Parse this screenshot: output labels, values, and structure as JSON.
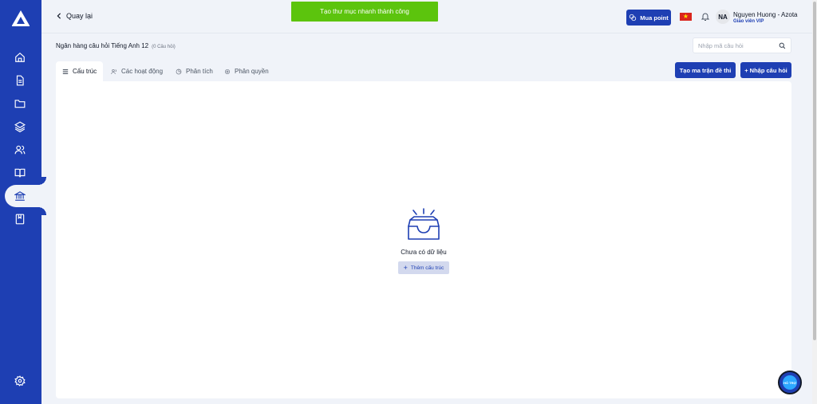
{
  "header": {
    "back_label": "Quay lại",
    "buy_point_label": "Mua point",
    "user_initials": "NA",
    "user_name": "Nguyen Huong - Azota",
    "user_role": "Giáo viên VIP"
  },
  "toast": {
    "message": "Tạo thư mục nhanh thành công"
  },
  "bank": {
    "title": "Ngân hàng câu hỏi Tiếng Anh 12",
    "count": "(0 Câu hỏi)"
  },
  "search": {
    "placeholder": "Nhập mã câu hỏi",
    "value": ""
  },
  "tabs": [
    {
      "label": "Cấu trúc",
      "icon": "list-icon",
      "active": true
    },
    {
      "label": "Các hoạt động",
      "icon": "users-icon",
      "active": false
    },
    {
      "label": "Phân tích",
      "icon": "pie-chart-icon",
      "active": false
    },
    {
      "label": "Phân quyền",
      "icon": "gear-icon",
      "active": false
    }
  ],
  "actions": {
    "create_matrix_label": "Tạo ma trận đề thi",
    "import_label": "+ Nhập câu hỏi"
  },
  "empty": {
    "message": "Chưa có dữ liệu",
    "add_label": "Thêm cấu trúc"
  },
  "support": {
    "label": "HỖ TRỢ"
  },
  "sidebar": {
    "items": [
      {
        "icon": "home-icon"
      },
      {
        "icon": "document-icon"
      },
      {
        "icon": "folder-icon"
      },
      {
        "icon": "layers-icon"
      },
      {
        "icon": "users-icon"
      },
      {
        "icon": "book-open-icon"
      },
      {
        "icon": "bank-icon",
        "active": true
      },
      {
        "icon": "notebook-icon"
      },
      {
        "icon": "gear-icon"
      }
    ]
  },
  "colors": {
    "brand": "#1e3fb3",
    "toast": "#5cc40d",
    "background": "#f0f3f9"
  }
}
